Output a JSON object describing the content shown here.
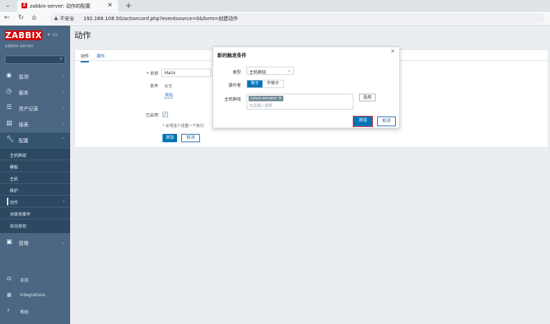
{
  "browser": {
    "tab_title": "zabbix-server: 动作的配置",
    "url_security": "不安全",
    "url": "192.168.108.50/actionconf.php?eventsource=0&form=创建动作"
  },
  "sidebar": {
    "logo": "ZABBIX",
    "server_name": "zabbix-server",
    "items": [
      {
        "label": "监测",
        "icon": "eye-icon"
      },
      {
        "label": "服务",
        "icon": "clock-icon"
      },
      {
        "label": "资产记录",
        "icon": "list-icon"
      },
      {
        "label": "报表",
        "icon": "chart-icon"
      },
      {
        "label": "配置",
        "icon": "wrench-icon"
      }
    ],
    "submenu": [
      {
        "label": "主机群组"
      },
      {
        "label": "模板"
      },
      {
        "label": "主机"
      },
      {
        "label": "维护"
      },
      {
        "label": "动作"
      },
      {
        "label": "关联项事件"
      },
      {
        "label": "自动发现"
      }
    ],
    "admin": {
      "label": "管理",
      "icon": "admin-icon"
    },
    "bottom": [
      {
        "label": "支持",
        "icon": "headset-icon"
      },
      {
        "label": "Integrations",
        "icon": "integrations-icon"
      },
      {
        "label": "帮助",
        "icon": "help-icon"
      }
    ]
  },
  "main": {
    "title": "动作",
    "tabs": [
      "动作",
      "操作"
    ],
    "name_label": "名称",
    "name_value": "Mailx",
    "conditions_label": "条件",
    "conditions_type": "标签",
    "conditions_add": "添加",
    "enabled_label": "已启用",
    "note": "* 必须至少设置一个执行",
    "add_button": "添加",
    "cancel_button": "取消"
  },
  "dialog": {
    "title": "新的触发条件",
    "type_label": "类型",
    "type_value": "主机群组",
    "operator_label": "操作者",
    "operator_equals": "等于",
    "operator_not_equals": "不等于",
    "hostgroups_label": "主机群组",
    "chip": "Linux servers",
    "search_placeholder": "在此输入搜索",
    "select_button": "选择",
    "add_button": "添加",
    "cancel_button": "取消"
  },
  "colors": {
    "sidebar": "#4b6784",
    "accent": "#0275b8",
    "logo": "#d40000"
  }
}
